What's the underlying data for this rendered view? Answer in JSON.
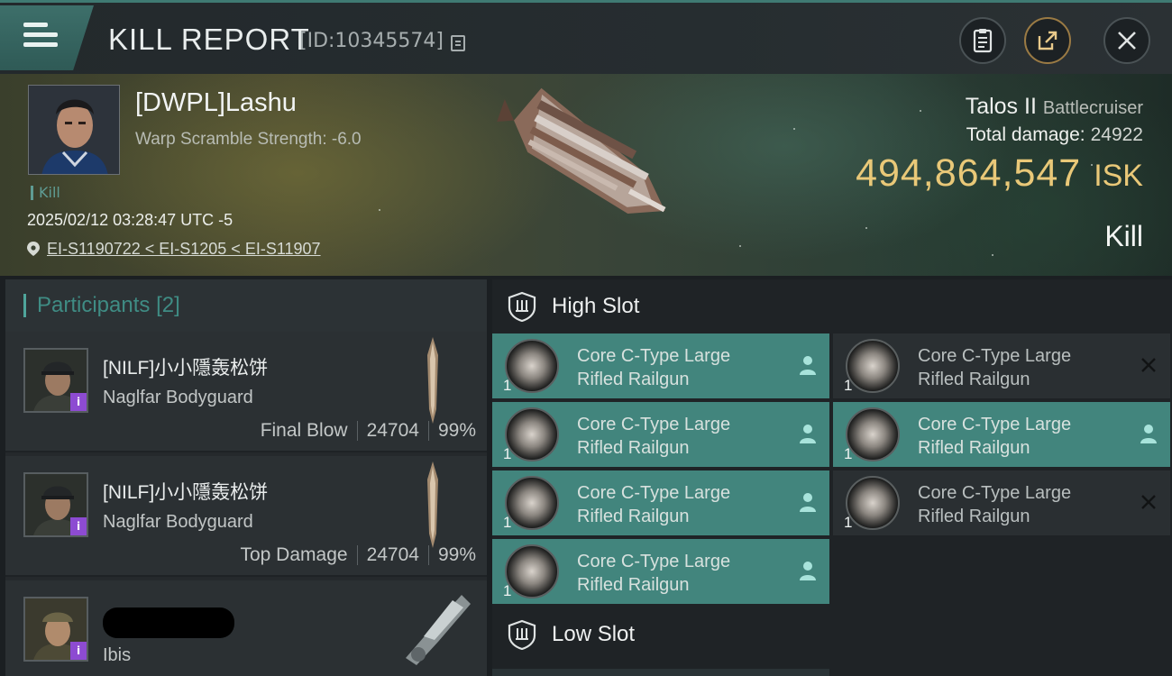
{
  "header": {
    "title": "KILL REPORT",
    "kill_id": "[ID:10345574]"
  },
  "victim": {
    "name": "[DWPL]Lashu",
    "warp_scramble": "Warp Scramble Strength: -6.0",
    "tag": "Kill",
    "timestamp": "2025/02/12 03:28:47 UTC -5",
    "location": "EI-S1190722 < EI-S1205 < EI-S11907",
    "ship_name": "Talos II",
    "ship_class": "Battlecruiser",
    "total_damage_label": "Total damage:",
    "total_damage_value": "24922",
    "isk_value": "494,864,547",
    "isk_unit": "ISK",
    "result": "Kill"
  },
  "participants": {
    "label": "Participants",
    "count": "[2]",
    "items": [
      {
        "name": "[NILF]小小隱轰松饼",
        "ship": "Naglfar Bodyguard",
        "role": "Final Blow",
        "damage": "24704",
        "percent": "99%",
        "badge": "i"
      },
      {
        "name": "[NILF]小小隱轰松饼",
        "ship": "Naglfar Bodyguard",
        "role": "Top Damage",
        "damage": "24704",
        "percent": "99%",
        "badge": "i"
      },
      {
        "name": "",
        "ship": "Ibis",
        "role": "",
        "damage": "",
        "percent": "",
        "badge": "i"
      }
    ]
  },
  "slots": {
    "high_label": "High Slot",
    "low_label": "Low Slot",
    "modules": [
      {
        "line1": "Core C-Type Large",
        "line2": "Rifled Railgun",
        "qty": "1",
        "state": "dropped"
      },
      {
        "line1": "Core C-Type Large",
        "line2": "Rifled Railgun",
        "qty": "1",
        "state": "destroyed"
      },
      {
        "line1": "Core C-Type Large",
        "line2": "Rifled Railgun",
        "qty": "1",
        "state": "dropped"
      },
      {
        "line1": "Core C-Type Large",
        "line2": "Rifled Railgun",
        "qty": "1",
        "state": "dropped"
      },
      {
        "line1": "Core C-Type Large",
        "line2": "Rifled Railgun",
        "qty": "1",
        "state": "dropped"
      },
      {
        "line1": "Core C-Type Large",
        "line2": "Rifled Railgun",
        "qty": "1",
        "state": "destroyed"
      },
      {
        "line1": "Core C-Type Large",
        "line2": "Rifled Railgun",
        "qty": "1",
        "state": "dropped"
      }
    ]
  },
  "colors": {
    "accent_teal": "#42857d",
    "isk_gold": "#e9c878",
    "badge_purple": "#8d4bd2"
  },
  "icons": [
    "menu-icon",
    "copy-icon",
    "clipboard-icon",
    "share-icon",
    "close-icon",
    "location-pin-icon",
    "shield-icon",
    "person-icon",
    "x-mark-icon"
  ]
}
